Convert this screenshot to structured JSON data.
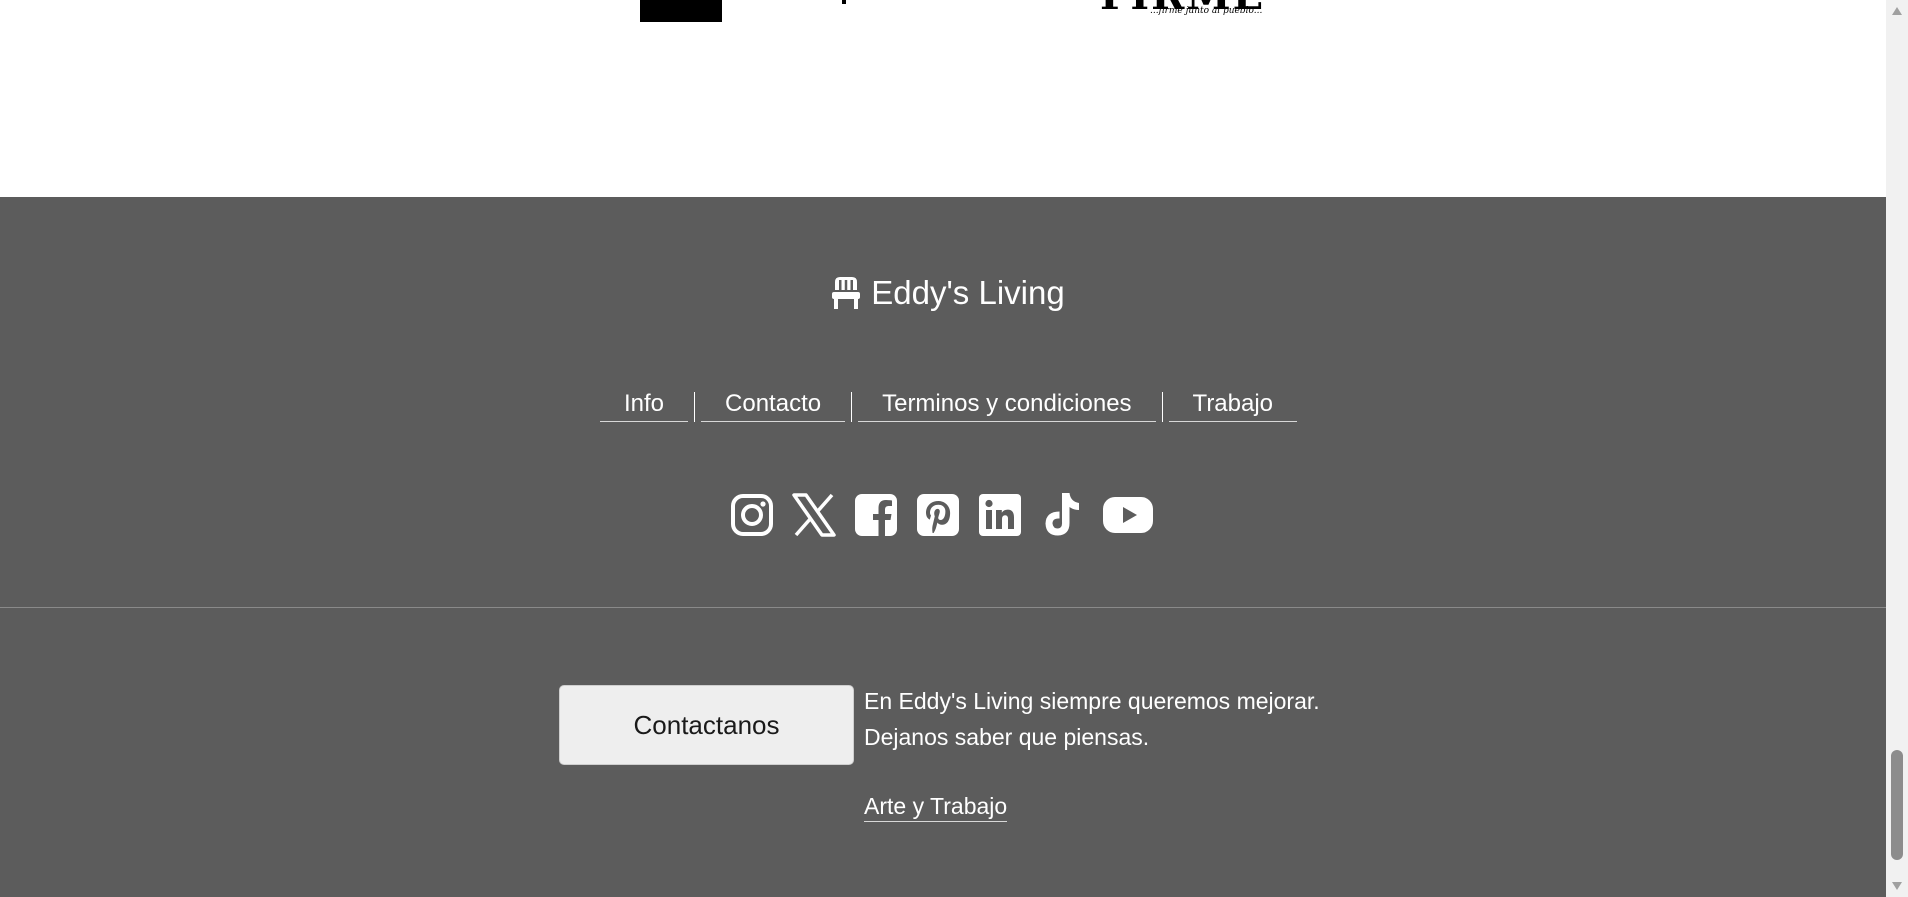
{
  "partner_logo": {
    "big_text": "FIRME",
    "small_text": "...firme junto al pueblo..."
  },
  "footer": {
    "brand": {
      "name": "Eddy's Living",
      "icon": "chair-icon"
    },
    "nav": [
      {
        "label": "Info"
      },
      {
        "label": "Contacto"
      },
      {
        "label": "Terminos y condiciones"
      },
      {
        "label": "Trabajo"
      }
    ],
    "social": [
      "instagram-icon",
      "x-icon",
      "facebook-icon",
      "pinterest-icon",
      "linkedin-icon",
      "tiktok-icon",
      "youtube-icon"
    ],
    "contact_button_label": "Contactanos",
    "contact_text_line1": "En Eddy's Living siempre queremos mejorar.",
    "contact_text_line2": "Dejanos saber que piensas.",
    "art_link_label": "Arte y Trabajo"
  },
  "colors": {
    "footer_bg": "#5c5c5c",
    "footer_text": "#ffffff",
    "button_bg": "#eeeeee"
  }
}
